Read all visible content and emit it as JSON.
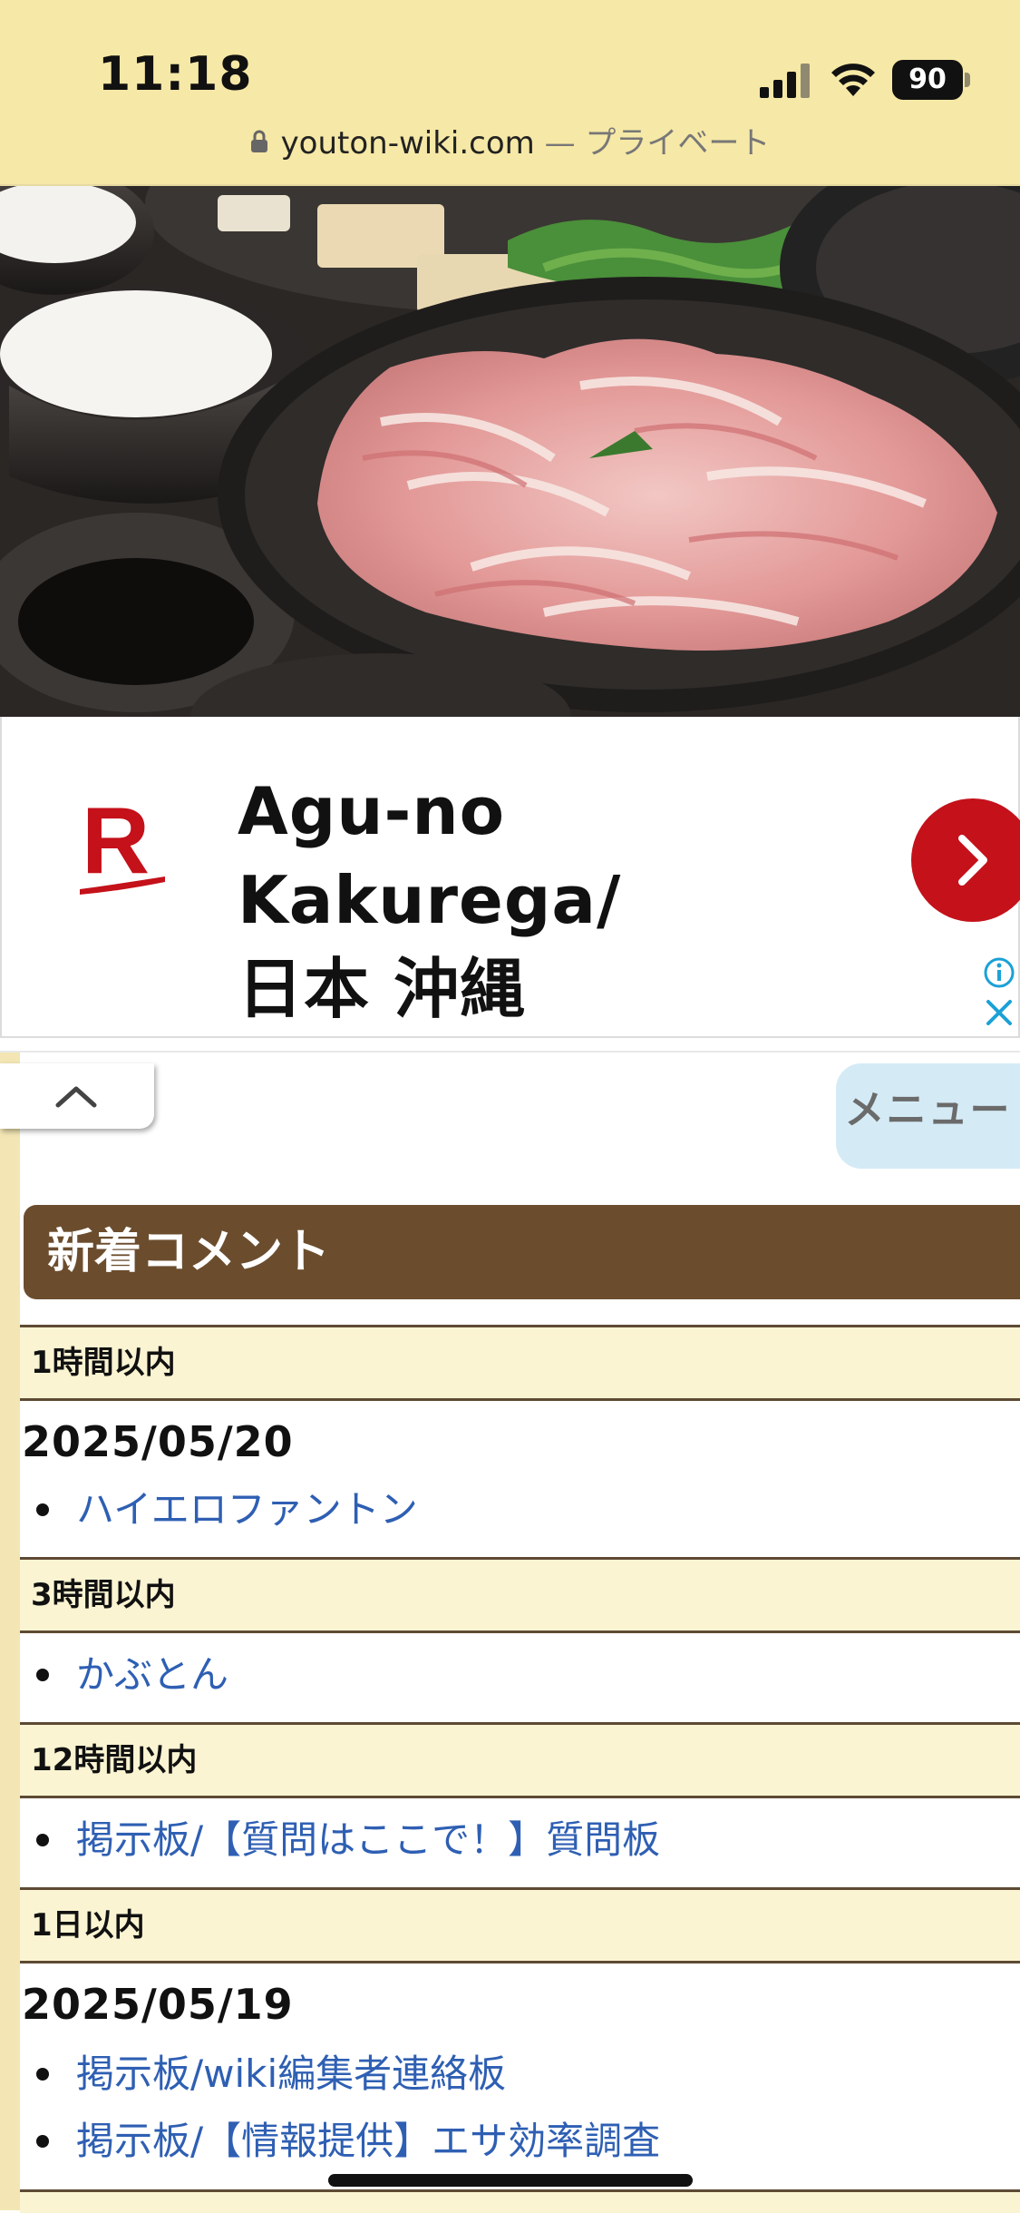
{
  "status_bar": {
    "time": "11:18",
    "battery": "90",
    "icons": [
      "signal-icon",
      "wifi-icon",
      "battery-icon"
    ]
  },
  "url_bar": {
    "domain": "youton-wiki.com",
    "separator": "—",
    "mode": "プライベート",
    "icon": "lock-icon"
  },
  "ad": {
    "title_line1": "Agu-no Kakurega/",
    "title_line2": "日本 沖縄",
    "logo_letter": "R",
    "icons": [
      "arrow-right-icon",
      "info-icon",
      "close-icon"
    ],
    "colors": {
      "brand": "#c4111a",
      "info": "#1ba1d6"
    }
  },
  "nav": {
    "menu_label": "メニュー",
    "collapse_icon": "chevron-up-icon"
  },
  "recent_comments": {
    "title": "新着コメント",
    "groups": [
      {
        "label": "1時間以内",
        "date": "2025/05/20",
        "items": [
          "ハイエロファントン"
        ]
      },
      {
        "label": "3時間以内",
        "date": "",
        "items": [
          "かぶとん"
        ]
      },
      {
        "label": "12時間以内",
        "date": "",
        "items": [
          "掲示板/【質問はここで！】質問板"
        ]
      },
      {
        "label": "1日以内",
        "date": "2025/05/19",
        "items": [
          "掲示板/wiki編集者連絡板",
          "掲示板/【情報提供】エサ効率調査"
        ]
      }
    ]
  },
  "colors": {
    "chrome_background": "#f6e8a6",
    "section_header": "#6b4d2e",
    "band_background": "#fbf4d2",
    "link": "#2e5fb3",
    "menu_button": "#d4ebf6"
  }
}
